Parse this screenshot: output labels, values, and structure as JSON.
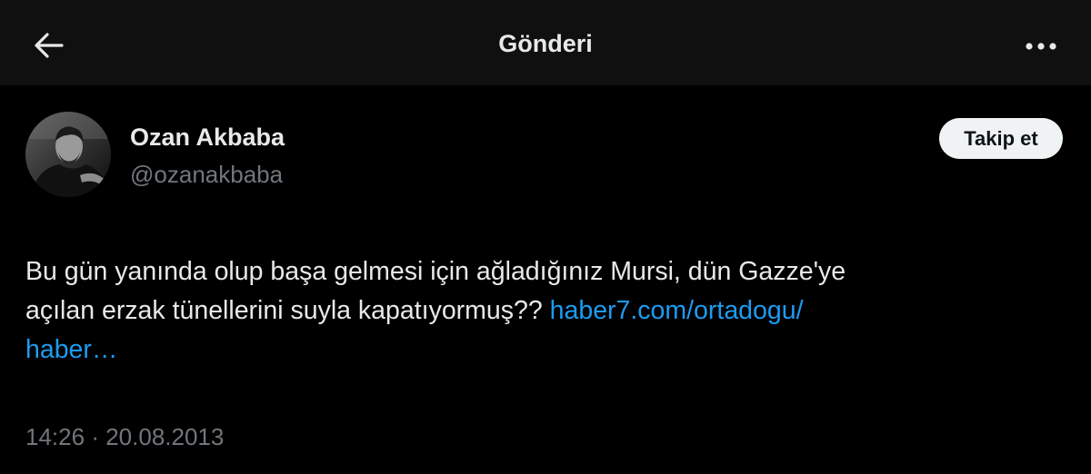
{
  "header": {
    "title": "Gönderi",
    "back_icon": "arrow-left-icon",
    "more_icon": "more-horizontal-icon"
  },
  "author": {
    "name": "Ozan Akbaba",
    "handle": "@ozanakbaba",
    "follow_label": "Takip et"
  },
  "tweet": {
    "text_line1": "Bu gün yanında olup başa gelmesi için ağladığınız Mursi, dün Gazze'ye",
    "text_line2": "açılan erzak tünellerini suyla kapatıyormuş??",
    "link_part1": "haber7.com/ortadogu/",
    "link_part2": "haber…",
    "time": "14:26",
    "separator": "·",
    "date": "20.08.2013"
  },
  "colors": {
    "background": "#000000",
    "header_background": "#101010",
    "text": "#e7e9ea",
    "secondary_text": "#71767b",
    "link": "#1d9bf0",
    "button_background": "#eff3f4"
  }
}
